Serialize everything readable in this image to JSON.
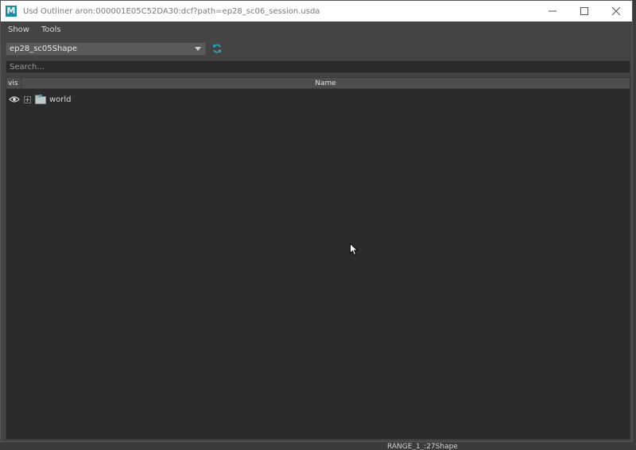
{
  "window": {
    "title": "Usd Outliner   aron:000001E05C52DA30:dcf?path=ep28_sc06_session.usda",
    "logo_letter": "M"
  },
  "menubar": {
    "items": [
      "Show",
      "Tools"
    ]
  },
  "toolbar": {
    "stage_selected": "ep28_sc05Shape"
  },
  "search": {
    "placeholder": "Search..."
  },
  "tree": {
    "columns": {
      "vis": "vis",
      "name": "Name"
    },
    "rows": [
      {
        "label": "world"
      }
    ]
  },
  "bottom": {
    "text": "RANGE_1_:27Shape"
  },
  "colors": {
    "accent": "#1a8ba0",
    "panel": "#2b2b2d",
    "window_bg": "#444444"
  },
  "icons": [
    "app-logo",
    "minimize-icon",
    "maximize-icon",
    "close-icon",
    "chevron-down-icon",
    "refresh-icon",
    "eye-icon",
    "expand-icon",
    "folder-icon",
    "cursor-icon"
  ]
}
